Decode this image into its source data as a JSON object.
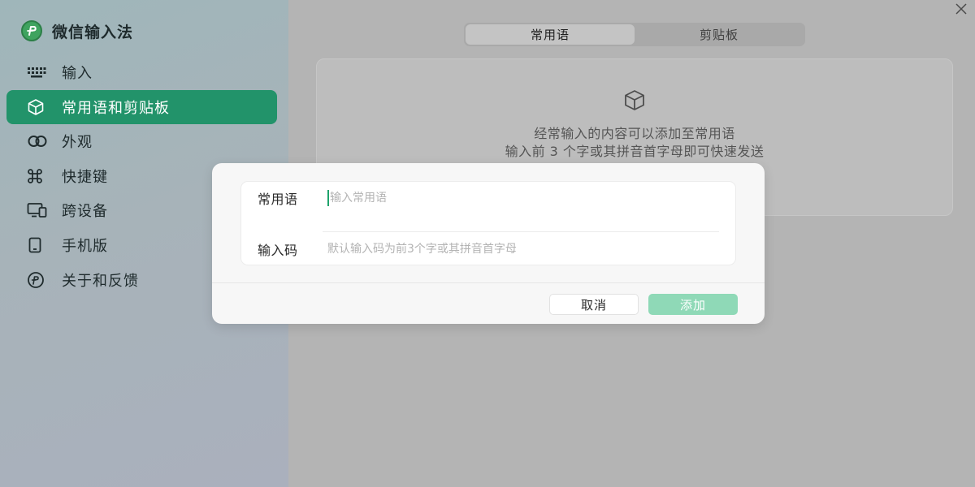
{
  "app": {
    "title": "微信输入法"
  },
  "sidebar": {
    "items": [
      {
        "label": "输入",
        "icon": "keyboard-icon",
        "active": false
      },
      {
        "label": "常用语和剪贴板",
        "icon": "box-icon",
        "active": true
      },
      {
        "label": "外观",
        "icon": "circles-icon",
        "active": false
      },
      {
        "label": "快捷键",
        "icon": "command-icon",
        "active": false
      },
      {
        "label": "跨设备",
        "icon": "devices-icon",
        "active": false
      },
      {
        "label": "手机版",
        "icon": "phone-icon",
        "active": false
      },
      {
        "label": "关于和反馈",
        "icon": "logo-outline-icon",
        "active": false
      }
    ]
  },
  "main": {
    "tabs": [
      {
        "label": "常用语",
        "active": true
      },
      {
        "label": "剪贴板",
        "active": false
      }
    ],
    "empty": {
      "line1": "经常输入的内容可以添加至常用语",
      "line2": "输入前 3 个字或其拼音首字母即可快速发送"
    }
  },
  "dialog": {
    "phrase_label": "常用语",
    "phrase_placeholder": "输入常用语",
    "code_label": "输入码",
    "code_placeholder": "默认输入码为前3个字或其拼音首字母",
    "cancel_label": "取消",
    "add_label": "添加"
  },
  "colors": {
    "accent": "#22936a",
    "add_button": "#8fd9b7",
    "caret": "#1ea36b"
  }
}
